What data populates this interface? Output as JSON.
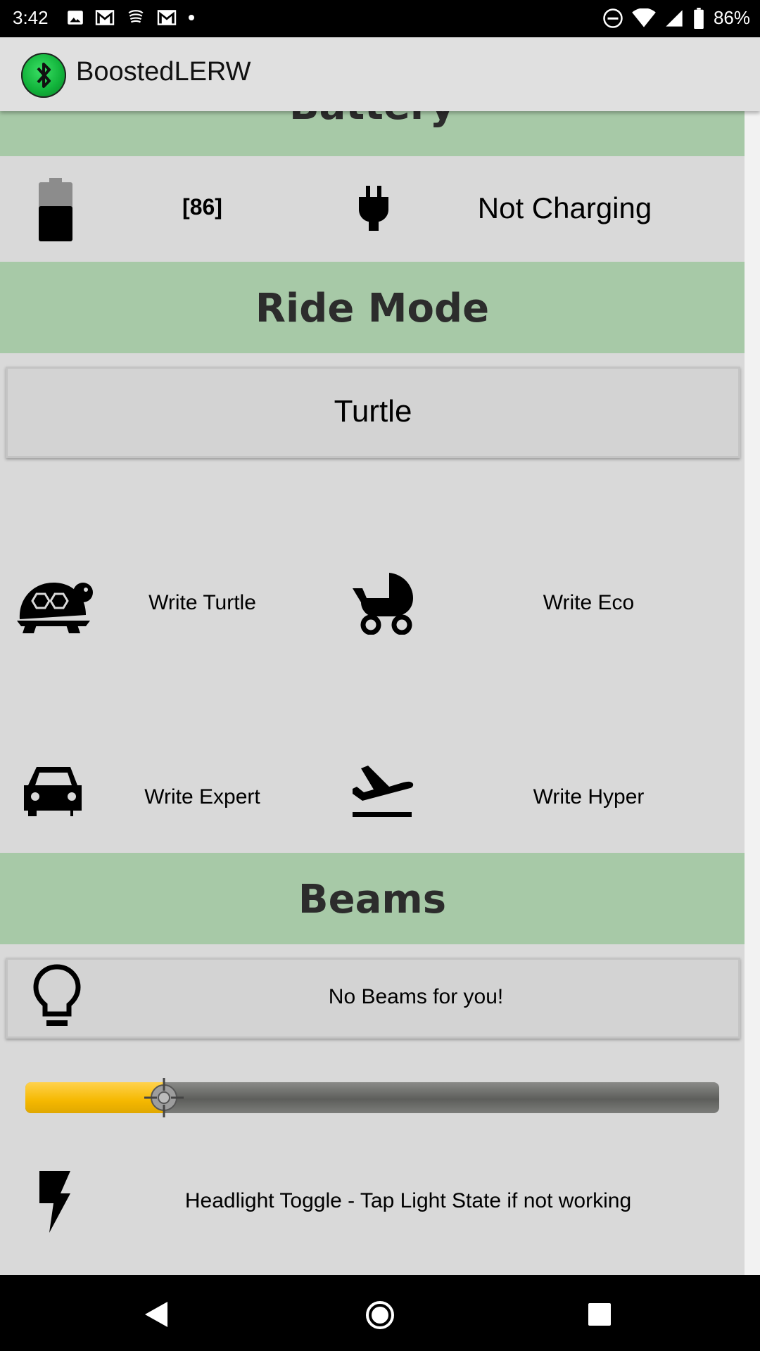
{
  "status_bar": {
    "time": "3:42",
    "battery": "86%"
  },
  "app_bar": {
    "title": "BoostedLERW"
  },
  "battery_section": {
    "header": "Battery",
    "level": "[86]",
    "charging_status": "Not Charging"
  },
  "ride_mode_section": {
    "header": "Ride Mode",
    "current_mode": "Turtle",
    "buttons": [
      {
        "label": "Write Turtle",
        "icon": "turtle-icon"
      },
      {
        "label": "Write Eco",
        "icon": "stroller-icon"
      },
      {
        "label": "Write Expert",
        "icon": "car-icon"
      },
      {
        "label": "Write Hyper",
        "icon": "airplane-takeoff-icon"
      }
    ]
  },
  "beams_section": {
    "header": "Beams",
    "status": "No Beams for you!",
    "brightness_fraction": 0.2,
    "headlight_toggle_label": "Headlight Toggle - Tap Light State if not working"
  },
  "colors": {
    "section_header": "#a7c9a7",
    "background": "#d9d9d9",
    "slider_fill": "#f5b800",
    "logo": "#11b23a"
  }
}
